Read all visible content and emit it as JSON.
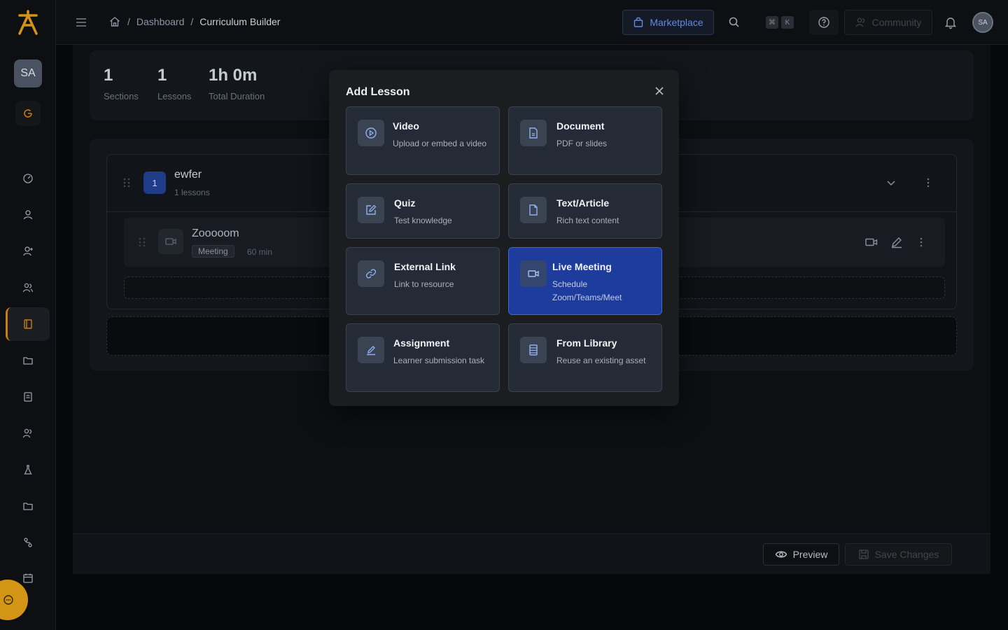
{
  "breadcrumb": {
    "home_label": "Home",
    "dashboard": "Dashboard",
    "current": "Curriculum Builder",
    "separator": "/"
  },
  "topbar": {
    "marketplace_label": "Marketplace",
    "kbd_cmd": "⌘",
    "kbd_k": "K",
    "community_label": "Community",
    "avatar_initials": "SA"
  },
  "sidebar": {
    "avatar_initials": "SA",
    "active_item": "curriculum"
  },
  "stats": [
    {
      "value": "1",
      "label": "Sections"
    },
    {
      "value": "1",
      "label": "Lessons"
    },
    {
      "value": "1h 0m",
      "label": "Total Duration"
    }
  ],
  "section": {
    "number": "1",
    "title": "ewfer",
    "subtitle": "1 lessons",
    "lesson": {
      "title": "Zooooom",
      "badge": "Meeting",
      "duration": "60 min"
    }
  },
  "footer": {
    "preview_label": "Preview",
    "save_label": "Save Changes"
  },
  "modal": {
    "title": "Add Lesson",
    "options": [
      {
        "title": "Video",
        "desc": "Upload or embed a video",
        "icon": "play-icon"
      },
      {
        "title": "Document",
        "desc": "PDF or slides",
        "icon": "document-icon"
      },
      {
        "title": "Quiz",
        "desc": "Test knowledge",
        "icon": "edit-square-icon"
      },
      {
        "title": "Text/Article",
        "desc": "Rich text content",
        "icon": "file-icon"
      },
      {
        "title": "External Link",
        "desc": "Link to resource",
        "icon": "link-icon"
      },
      {
        "title": "Live Meeting",
        "desc": "Schedule Zoom/Teams/Meet",
        "icon": "video-camera-icon",
        "selected": true
      },
      {
        "title": "Assignment",
        "desc": "Learner submission task",
        "icon": "pen-icon"
      },
      {
        "title": "From Library",
        "desc": "Reuse an existing asset",
        "icon": "library-icon"
      }
    ]
  },
  "colors": {
    "accent": "#d39516",
    "selected_card": "#1d3c9c",
    "brand_blue": "#5f8ae0"
  }
}
